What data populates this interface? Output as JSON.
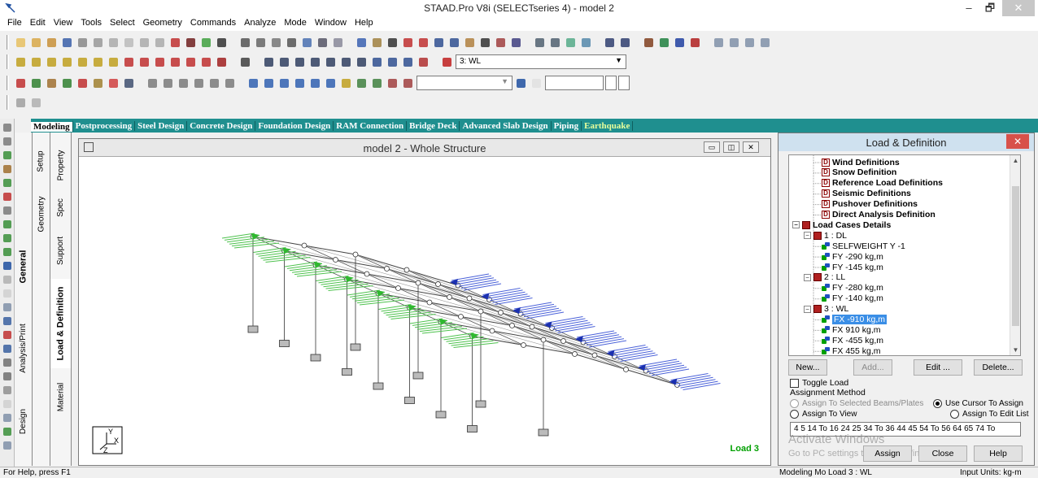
{
  "window": {
    "title": "STAAD.Pro V8i (SELECTseries 4) - model 2",
    "minimize": "–",
    "maximize": "🗗",
    "close": "✕"
  },
  "menu": [
    "File",
    "Edit",
    "View",
    "Tools",
    "Select",
    "Geometry",
    "Commands",
    "Analyze",
    "Mode",
    "Window",
    "Help"
  ],
  "toolbar": {
    "load_case_select": "3: WL"
  },
  "page_tabs": [
    {
      "label": "Modeling",
      "active": true
    },
    {
      "label": "Postprocessing"
    },
    {
      "label": "Steel Design"
    },
    {
      "label": "Concrete Design"
    },
    {
      "label": "Foundation Design"
    },
    {
      "label": "RAM Connection"
    },
    {
      "label": "Bridge Deck"
    },
    {
      "label": "Advanced Slab Design"
    },
    {
      "label": "Piping"
    },
    {
      "label": "Earthquake",
      "ghost": true
    }
  ],
  "vertical_tabs": {
    "group": [
      "General",
      "Analysis/Print",
      "Design"
    ],
    "general": [
      "Setup",
      "Geometry",
      "Property",
      "Spec",
      "Support",
      "Load & Definition",
      "Material"
    ]
  },
  "structure_window": {
    "title": "model 2 - Whole Structure",
    "load_label": "Load 3",
    "axis_labels": {
      "y": "Y",
      "x": "X",
      "z": "Z"
    }
  },
  "load_panel": {
    "title": "Load & Definition",
    "close": "✕",
    "tree": [
      {
        "label": "Wind Definitions",
        "level": 2,
        "icon": "D",
        "bold": true
      },
      {
        "label": "Snow Definition",
        "level": 2,
        "icon": "D",
        "bold": true
      },
      {
        "label": "Reference Load Definitions",
        "level": 2,
        "icon": "D",
        "bold": true
      },
      {
        "label": "Seismic Definitions",
        "level": 2,
        "icon": "D",
        "bold": true
      },
      {
        "label": "Pushover Definitions",
        "level": 2,
        "icon": "D",
        "bold": true
      },
      {
        "label": "Direct Analysis Definition",
        "level": 2,
        "icon": "D",
        "bold": true
      },
      {
        "label": "Load Cases Details",
        "level": 0,
        "icon": "L",
        "bold": true,
        "expander": "−"
      },
      {
        "label": "1 : DL",
        "level": 1,
        "icon": "L",
        "expander": "−"
      },
      {
        "label": "SELFWEIGHT Y -1",
        "level": 2,
        "icon": "g"
      },
      {
        "label": "FY -290 kg,m",
        "level": 2,
        "icon": "g"
      },
      {
        "label": "FY -145 kg,m",
        "level": 2,
        "icon": "g"
      },
      {
        "label": "2 : LL",
        "level": 1,
        "icon": "L",
        "expander": "−"
      },
      {
        "label": "FY -280 kg,m",
        "level": 2,
        "icon": "g"
      },
      {
        "label": "FY -140 kg,m",
        "level": 2,
        "icon": "g"
      },
      {
        "label": "3 : WL",
        "level": 1,
        "icon": "L",
        "expander": "−"
      },
      {
        "label": "FX -910 kg,m",
        "level": 2,
        "icon": "g",
        "selected": true
      },
      {
        "label": "FX 910 kg,m",
        "level": 2,
        "icon": "g"
      },
      {
        "label": "FX -455 kg,m",
        "level": 2,
        "icon": "g"
      },
      {
        "label": "FX 455 kg,m",
        "level": 2,
        "icon": "g"
      }
    ],
    "buttons": {
      "new": "New...",
      "add": "Add...",
      "edit": "Edit ...",
      "delete": "Delete..."
    },
    "toggle_load": "Toggle Load",
    "assignment_method": "Assignment Method",
    "radios": {
      "selected_beams": "Assign To Selected Beams/Plates",
      "use_cursor": "Use Cursor To Assign",
      "assign_view": "Assign To View",
      "edit_list": "Assign To Edit List"
    },
    "assign_list": "4 5 14 To 16 24 25 34 To 36 44 45 54 To 56 64 65 74 To",
    "watermark_1": "Activate Windows",
    "watermark_2": "Go to PC settings to activate Windows.",
    "assign_button": "Assign",
    "close_button": "Close",
    "help_button": "Help"
  },
  "status": {
    "help": "For Help, press F1",
    "mode": "Modeling Mo Load 3 : WL",
    "units": "Input Units:  kg-m"
  }
}
